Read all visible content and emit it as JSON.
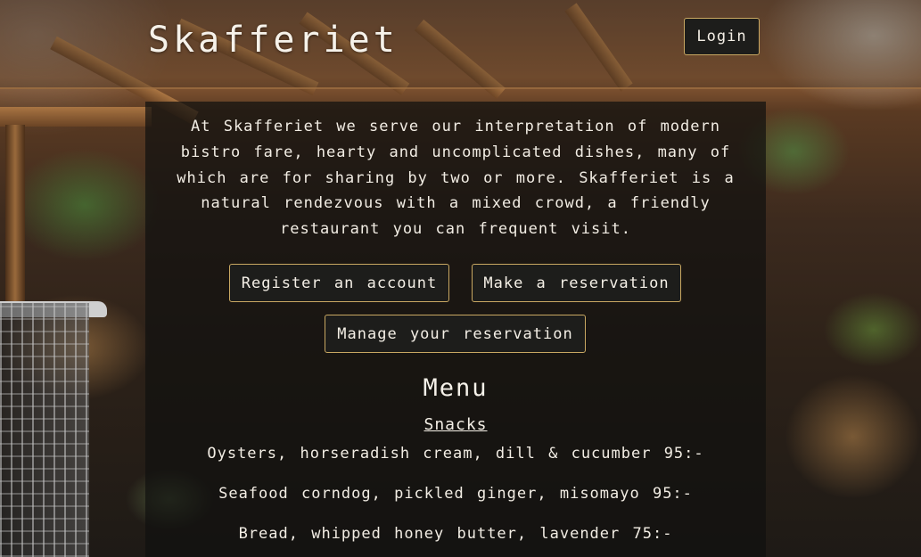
{
  "header": {
    "brand": "Skafferiet",
    "login_label": "Login"
  },
  "intro": {
    "text": "At Skafferiet we serve our interpretation of modern bistro fare, hearty and uncomplicated dishes, many of which are for sharing by two or more. Skafferiet is a natural rendezvous with a mixed crowd, a friendly restaurant you can frequent visit."
  },
  "actions": {
    "register_label": "Register an account",
    "reservation_label": "Make a reservation",
    "manage_label": "Manage your reservation"
  },
  "menu": {
    "title": "Menu",
    "section": "Snacks",
    "items": [
      "Oysters, horseradish cream, dill & cucumber 95:-",
      "Seafood corndog, pickled ginger, misomayo 95:-",
      "Bread, whipped honey butter, lavender 75:-"
    ]
  },
  "colors": {
    "button_bg": "#1d1d1b",
    "button_border": "#c9a862",
    "text": "#f4efe6"
  }
}
